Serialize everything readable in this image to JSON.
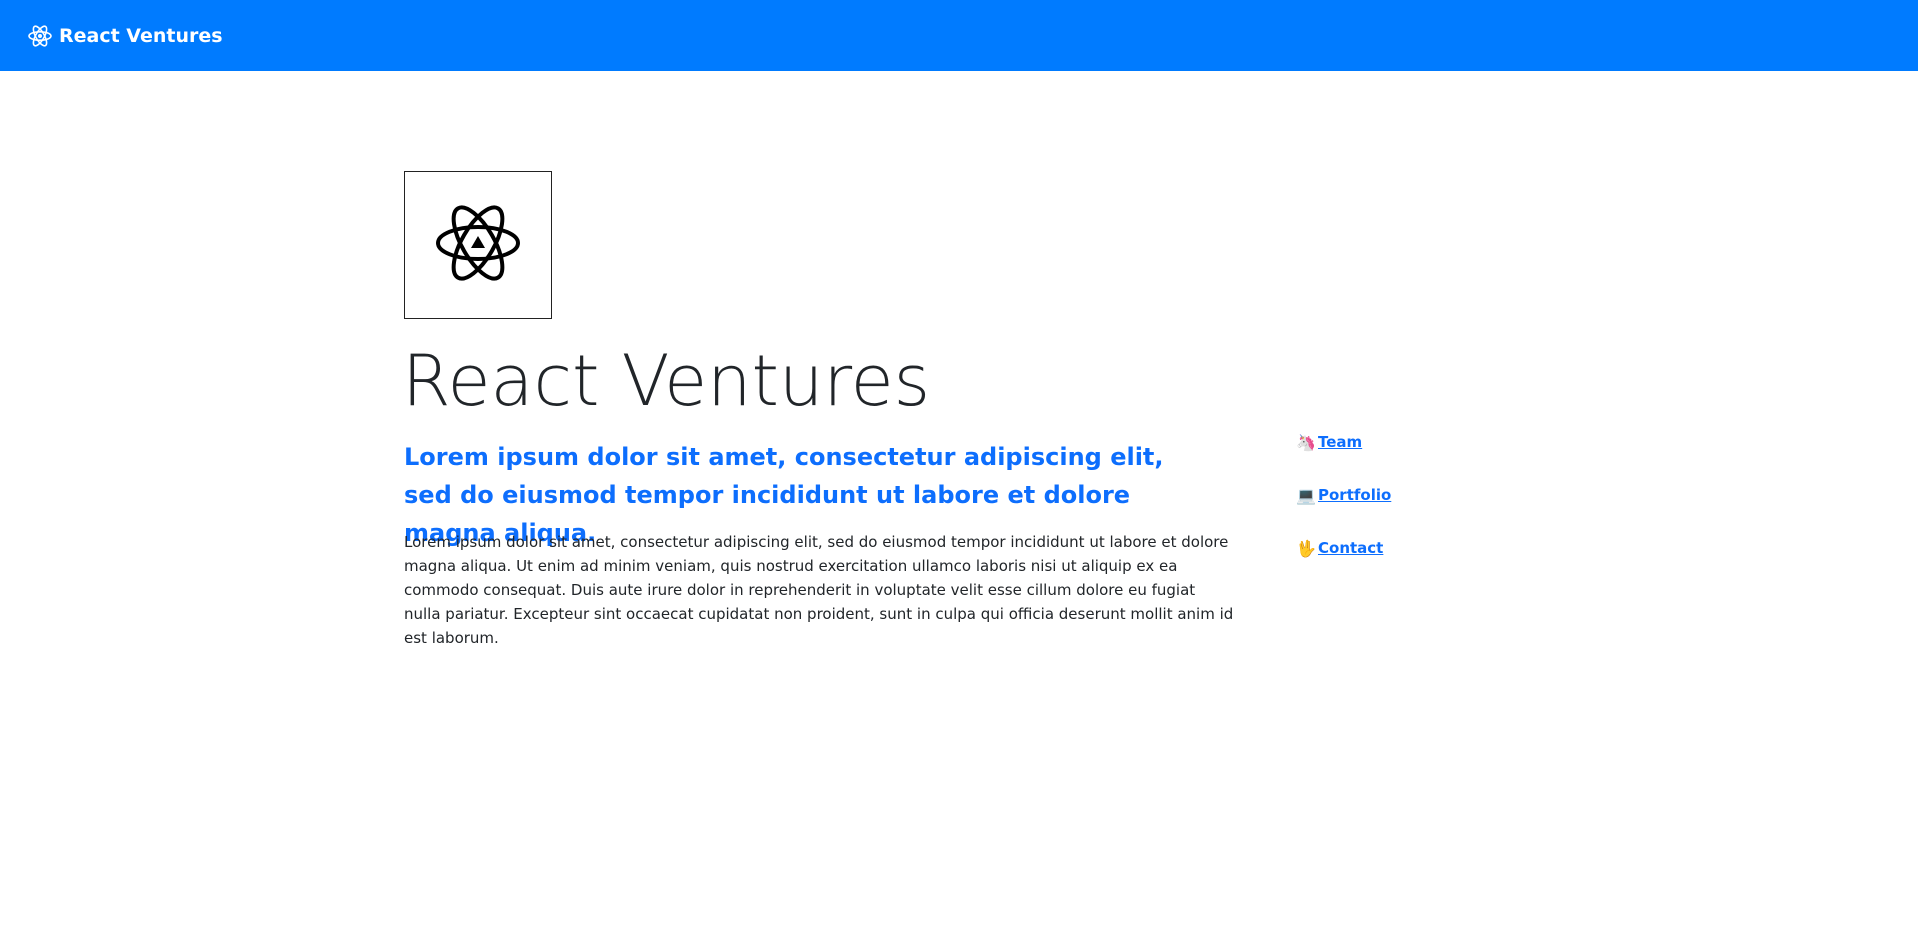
{
  "navbar": {
    "brand_label": "React Ventures",
    "brand_icon": "react-atom-icon",
    "background_color": "#007bff"
  },
  "hero": {
    "logo_icon": "react-atom-logo-icon",
    "title": "React Ventures",
    "lead": "Lorem ipsum dolor sit amet, consectetur adipiscing elit, sed do eiusmod tempor incididunt ut labore et dolore magna aliqua.",
    "body": "Lorem ipsum dolor sit amet, consectetur adipiscing elit, sed do eiusmod tempor incididunt ut labore et dolore magna aliqua. Ut enim ad minim veniam, quis nostrud exercitation ullamco laboris nisi ut aliquip ex ea commodo consequat. Duis aute irure dolor in reprehenderit in voluptate velit esse cillum dolore eu fugiat nulla pariatur. Excepteur sint occaecat cupidatat non proident, sunt in culpa qui officia deserunt mollit anim id est laborum."
  },
  "side_links": [
    {
      "emoji": "🦄",
      "icon": "unicorn-icon",
      "label": "Team"
    },
    {
      "emoji": "💻",
      "icon": "laptop-icon",
      "label": "Portfolio"
    },
    {
      "emoji": "🖖",
      "icon": "vulcan-salute-icon",
      "label": "Contact"
    }
  ],
  "colors": {
    "accent": "#0d6efd",
    "text": "#212529"
  }
}
